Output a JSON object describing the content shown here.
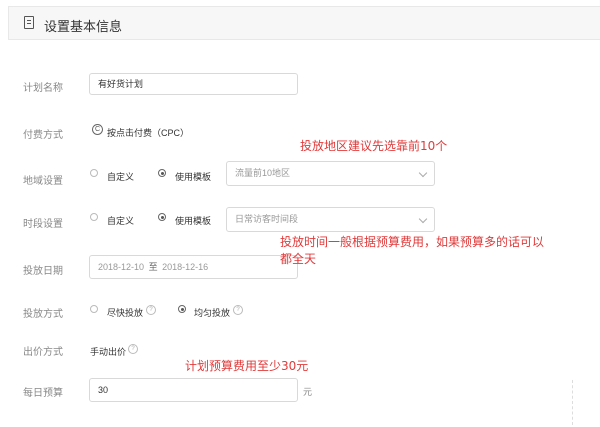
{
  "header": {
    "title": "设置基本信息"
  },
  "plan_name": {
    "label": "计划名称",
    "value": "有好货计划"
  },
  "billing": {
    "label": "付费方式",
    "icon_char": "C",
    "value": "按点击付费（CPC）"
  },
  "region": {
    "label": "地域设置",
    "option_custom": "自定义",
    "option_template": "使用模板",
    "select_value": "流量前10地区"
  },
  "time_slot": {
    "label": "时段设置",
    "option_custom": "自定义",
    "option_template": "使用模板",
    "select_value": "日常访客时间段"
  },
  "dates": {
    "label": "投放日期",
    "start": "2018-12-10",
    "sep": "至",
    "end": "2018-12-16"
  },
  "delivery": {
    "label": "投放方式",
    "option_fast": "尽快投放",
    "option_even": "均匀投放"
  },
  "bid": {
    "label": "出价方式",
    "value": "手动出价"
  },
  "budget": {
    "label": "每日预算",
    "value": "30",
    "unit": "元"
  },
  "notes": {
    "region_tip": "投放地区建议先选靠前10个",
    "time_tip_line1": "投放时间一般根据预算费用，如果预算多的话可以",
    "time_tip_line2": "都全天",
    "budget_tip": "计划预算费用至少30元"
  },
  "icons": {
    "help": "?",
    "document": "document-icon"
  },
  "colors": {
    "note": "#e03a3a",
    "label": "#888888",
    "border": "#d9d9d9"
  }
}
